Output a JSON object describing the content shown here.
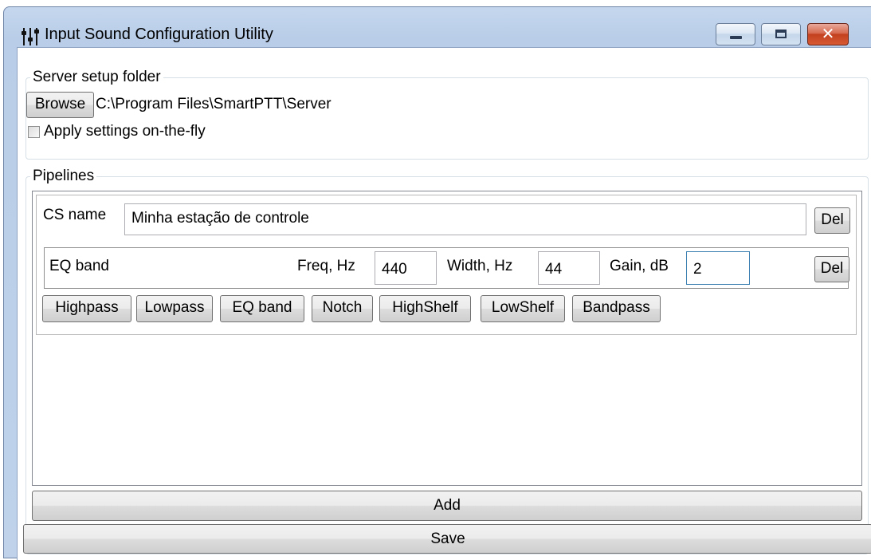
{
  "window": {
    "title": "Input Sound Configuration Utility",
    "close_glyph": "✕"
  },
  "server_setup": {
    "legend": "Server setup folder",
    "browse_label": "Browse",
    "path": "C:\\Program Files\\SmartPTT\\Server",
    "apply_label": "Apply settings on-the-fly",
    "apply_checked": false
  },
  "pipelines": {
    "legend": "Pipelines",
    "items": [
      {
        "cs_name_label": "CS name",
        "cs_name_value": "Minha estação de controle",
        "del_label": "Del",
        "bands": [
          {
            "type_label": "EQ band",
            "freq_label": "Freq, Hz",
            "freq_value": "440",
            "width_label": "Width, Hz",
            "width_value": "44",
            "gain_label": "Gain, dB",
            "gain_value": "2",
            "del_label": "Del"
          }
        ],
        "filter_buttons": [
          "Highpass",
          "Lowpass",
          "EQ band",
          "Notch",
          "HighShelf",
          "LowShelf",
          "Bandpass"
        ]
      }
    ],
    "add_label": "Add"
  },
  "save_label": "Save"
}
